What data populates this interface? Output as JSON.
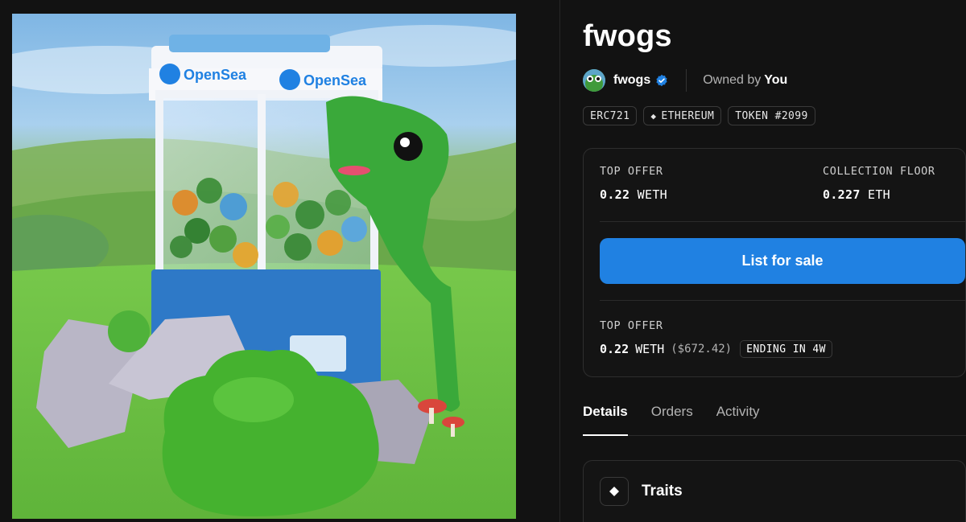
{
  "nft": {
    "title": "fwogs",
    "image_alt": "fwogs NFT artwork",
    "machine_brand_left": "OpenSea",
    "machine_brand_right": "OpenSea"
  },
  "collection": {
    "name": "fwogs",
    "verified": true,
    "owned_prefix": "Owned by",
    "owner": "You"
  },
  "chips": [
    {
      "label": "ERC721",
      "icon": ""
    },
    {
      "label": "ETHEREUM",
      "icon": "ethereum-icon"
    },
    {
      "label": "TOKEN #2099",
      "icon": ""
    }
  ],
  "stats": {
    "top_offer_label": "TOP OFFER",
    "top_offer_amount": "0.22",
    "top_offer_currency": "WETH",
    "floor_label": "COLLECTION FLOOR",
    "floor_amount": "0.227",
    "floor_currency": "ETH"
  },
  "list_button_label": "List for sale",
  "offer": {
    "label": "TOP OFFER",
    "amount": "0.22",
    "currency": "WETH",
    "usd": "($672.42)",
    "ending": "ENDING IN 4W"
  },
  "tabs": [
    {
      "label": "Details",
      "active": true
    },
    {
      "label": "Orders",
      "active": false
    },
    {
      "label": "Activity",
      "active": false
    }
  ],
  "traits_label": "Traits",
  "colors": {
    "background": "#121212",
    "accent_blue": "#2081e2",
    "verified_blue": "#2081e2"
  }
}
